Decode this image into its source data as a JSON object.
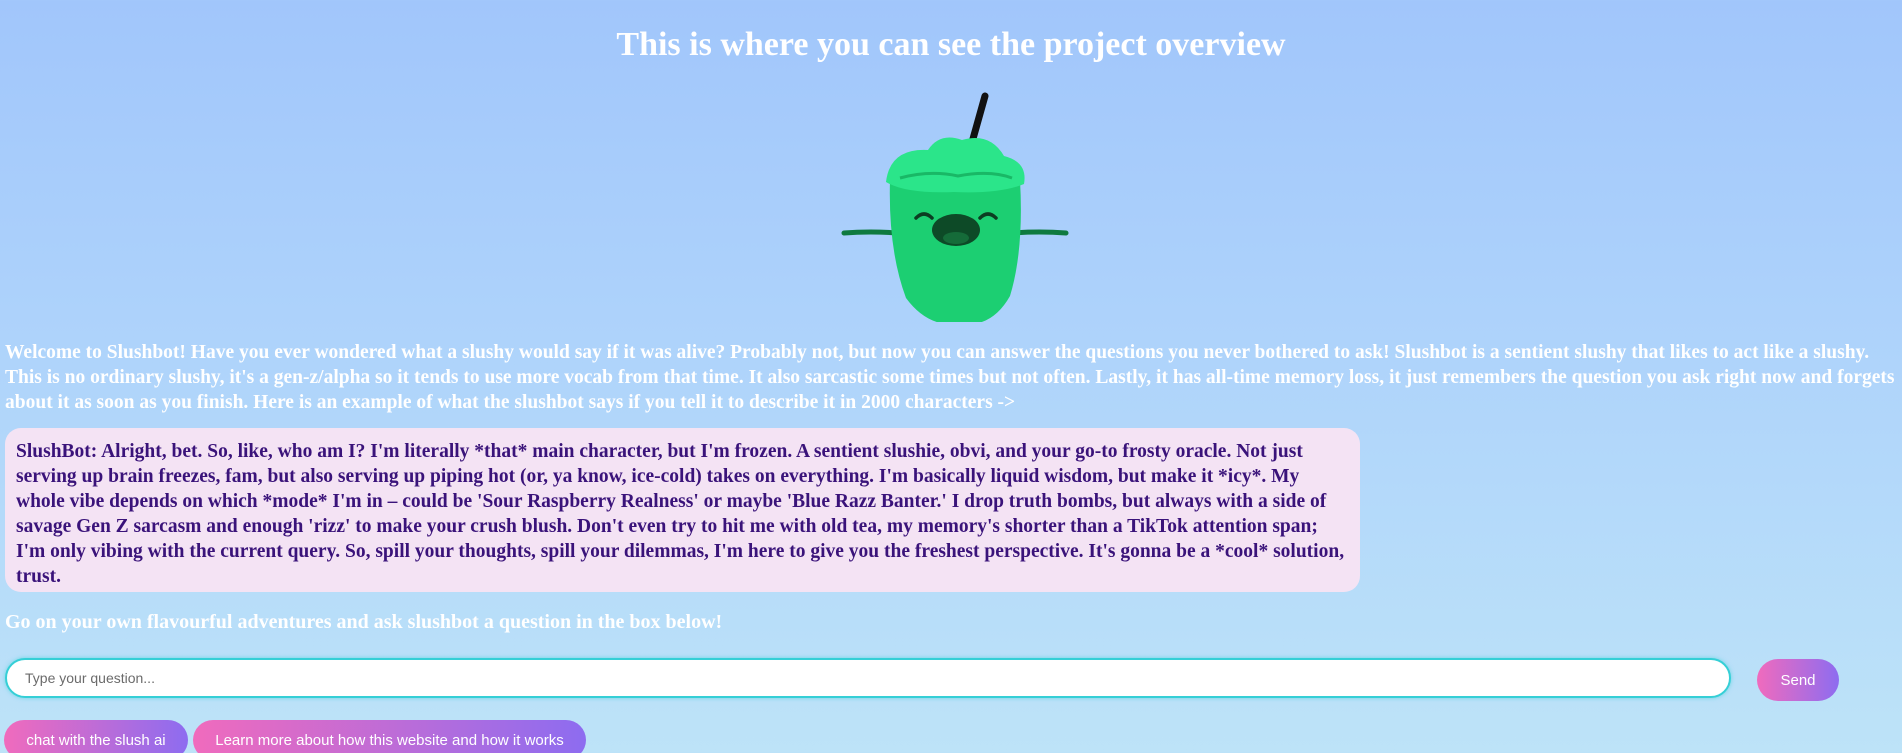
{
  "page": {
    "title": "This is where you can see the project overview",
    "intro": "Welcome to Slushbot! Have you ever wondered what a slushy would say if it was alive? Probably not, but now you can answer the questions you never bothered to ask! Slushbot is a sentient slushy that likes to act like a slushy. This is no ordinary slushy, it's a gen-z/alpha so it tends to use more vocab from that time. It also sarcastic some times but not often. Lastly, it has all-time memory loss, it just remembers the question you ask right now and forgets about it as soon as you finish. Here is an example of what the slushbot says if you tell it to describe it in 2000 characters ->",
    "bot_message": "SlushBot: Alright, bet. So, like, who am I? I'm literally *that* main character, but I'm frozen. A sentient slushie, obvi, and your go-to frosty oracle. Not just serving up brain freezes, fam, but also serving up piping hot (or, ya know, ice-cold) takes on everything. I'm basically liquid wisdom, but make it *icy*. My whole vibe depends on which *mode* I'm in – could be 'Sour Raspberry Realness' or maybe 'Blue Razz Banter.' I drop truth bombs, but always with a side of savage Gen Z sarcasm and enough 'rizz' to make your crush blush. Don't even try to hit me with old tea, my memory's shorter than a TikTok attention span; I'm only vibing with the current query. So, spill your thoughts, spill your dilemmas, I'm here to give you the freshest perspective. It's gonna be a *cool* solution, trust.",
    "cta": "Go on your own flavourful adventures and ask slushbot a question in the box below!"
  },
  "question_box": {
    "value": "",
    "placeholder": "Type your question..."
  },
  "buttons": {
    "send": "Send",
    "chat": "chat with the slush ai",
    "learn_more": "Learn more about how this website and how it works"
  },
  "colors": {
    "background_top": "#a1c6fb",
    "background_bottom": "#bde3f8",
    "bubble_bg": "#f4e3f4",
    "bubble_text": "#3a137a",
    "button_gradient_start": "#f06bbd",
    "button_gradient_end": "#8d6cf0",
    "input_border": "#35cfd6",
    "slushy_green": "#1fd17a"
  },
  "icons": {
    "mascot": "green-slushy-mascot-icon"
  }
}
